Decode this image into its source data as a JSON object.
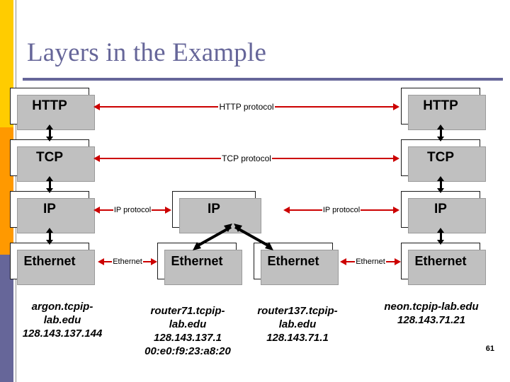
{
  "slide": {
    "title": "Layers in the Example",
    "page_number": "61",
    "accent_color": "#666699",
    "bar_colors": [
      "#ffcc00",
      "#ff9900",
      "#666699"
    ],
    "arrow_color": "#cc0000"
  },
  "stacks": {
    "left": {
      "name": "argon",
      "layers": [
        "HTTP",
        "TCP",
        "IP",
        "Ethernet"
      ]
    },
    "router71": {
      "name": "router71",
      "layers": [
        "IP",
        "Ethernet",
        "Ethernet"
      ]
    },
    "right": {
      "name": "neon",
      "layers": [
        "HTTP",
        "TCP",
        "IP",
        "Ethernet"
      ]
    }
  },
  "layer_labels": {
    "left_http": "HTTP",
    "left_tcp": "TCP",
    "left_ip": "IP",
    "left_eth": "Ethernet",
    "mid_ip": "IP",
    "mid_eth_left": "Ethernet",
    "mid_eth_right": "Ethernet",
    "right_http": "HTTP",
    "right_tcp": "TCP",
    "right_ip": "IP",
    "right_eth": "Ethernet"
  },
  "protocols": {
    "http": "HTTP protocol",
    "tcp": "TCP protocol",
    "ip_left": "IP protocol",
    "ip_right": "IP protocol",
    "eth_left": "Ethernet",
    "eth_right": "Ethernet"
  },
  "captions": {
    "argon": {
      "host_line1": "argon.tcpip-",
      "host_line2": "lab.edu",
      "ip": "128.143.137.144"
    },
    "router71": {
      "host_line1": "router71.tcpip-",
      "host_line2": "lab.edu",
      "ip": "128.143.137.1",
      "mac": "00:e0:f9:23:a8:20"
    },
    "router137": {
      "host_line1": "router137.tcpip-",
      "host_line2": "lab.edu",
      "ip": "128.143.71.1"
    },
    "neon": {
      "host_line1": "neon.tcpip-lab.edu",
      "ip": "128.143.71.21"
    }
  }
}
